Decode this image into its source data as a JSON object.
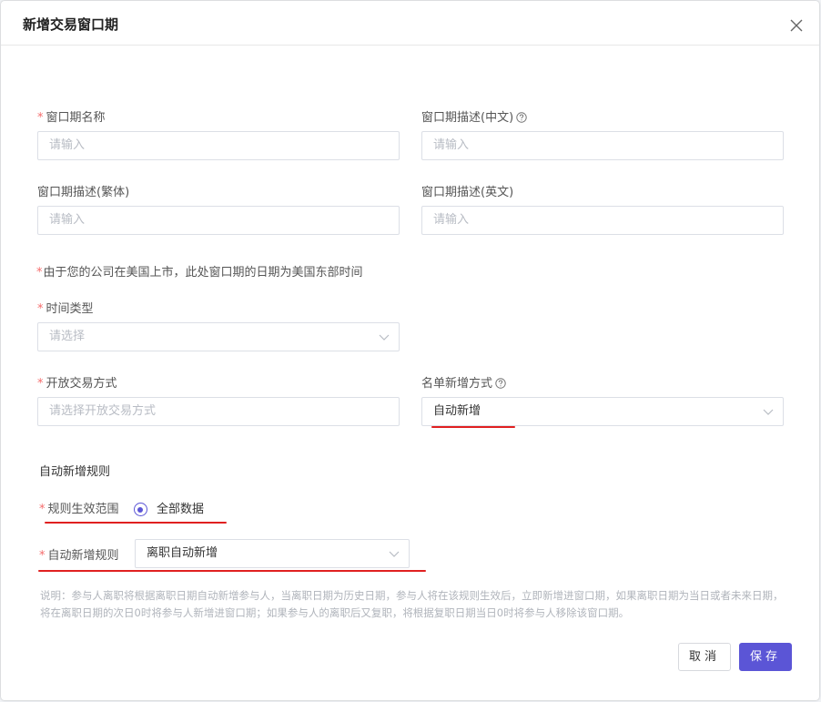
{
  "dialog": {
    "title": "新增交易窗口期",
    "close_icon": "close-icon"
  },
  "fields": {
    "name": {
      "label": "窗口期名称",
      "placeholder": "请输入"
    },
    "desc_cn": {
      "label": "窗口期描述(中文)",
      "placeholder": "请输入"
    },
    "desc_tw": {
      "label": "窗口期描述(繁体)",
      "placeholder": "请输入"
    },
    "desc_en": {
      "label": "窗口期描述(英文)",
      "placeholder": "请输入"
    },
    "timezone_note": "由于您的公司在美国上市，此处窗口期的日期为美国东部时间",
    "time_type": {
      "label": "时间类型",
      "placeholder": "请选择"
    },
    "open_mode": {
      "label": "开放交易方式",
      "placeholder": "请选择开放交易方式"
    },
    "list_add_mode": {
      "label": "名单新增方式",
      "value": "自动新增"
    }
  },
  "auto_rules": {
    "section_title": "自动新增规则",
    "scope_label": "规则生效范围",
    "scope_option": "全部数据",
    "rule_label": "自动新增规则",
    "rule_value": "离职自动新增",
    "description": "说明：参与人离职将根据离职日期自动新增参与人，当离职日期为历史日期，参与人将在该规则生效后，立即新增进窗口期，如果离职日期为当日或者未来日期，将在离职日期的次日0时将参与人新增进窗口期；如果参与人的离职后又复职，将根据复职日期当日0时将参与人移除该窗口期。"
  },
  "buttons": {
    "cancel": "取消",
    "save": "保存"
  },
  "colors": {
    "accent": "#5b55d6",
    "required": "#f56c6c",
    "annotation": "#e02020"
  }
}
